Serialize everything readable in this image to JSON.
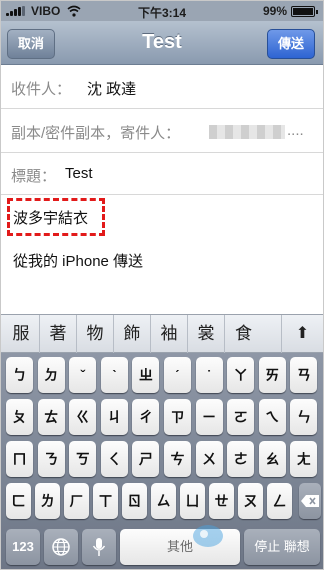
{
  "status_bar": {
    "carrier": "VIBO",
    "time": "下午3:14",
    "battery": "99%"
  },
  "nav": {
    "cancel": "取消",
    "title": "Test",
    "send": "傳送"
  },
  "form": {
    "to_label": "收件人：",
    "to_value": "沈 政達",
    "cc_label": "副本/密件副本，寄件人：",
    "cc_more": "....",
    "subject_label": "標題：",
    "subject_value": "Test"
  },
  "body": {
    "typed_text": "波多宇結衣",
    "signature": "從我的 iPhone 傳送"
  },
  "candidates": {
    "items": [
      "服",
      "著",
      "物",
      "飾",
      "袖",
      "裳",
      "食"
    ],
    "expand": "⬆"
  },
  "keyboard": {
    "row1": [
      "ㄅ",
      "ㄉ",
      "ˇ",
      "ˋ",
      "ㄓ",
      "ˊ",
      "˙",
      "ㄚ",
      "ㄞ",
      "ㄢ"
    ],
    "row2": [
      "ㄆ",
      "ㄊ",
      "ㄍ",
      "ㄐ",
      "ㄔ",
      "ㄗ",
      "ㄧ",
      "ㄛ",
      "ㄟ",
      "ㄣ"
    ],
    "row3": [
      "ㄇ",
      "ㄋ",
      "ㄎ",
      "ㄑ",
      "ㄕ",
      "ㄘ",
      "ㄨ",
      "ㄜ",
      "ㄠ",
      "ㄤ"
    ],
    "row4": [
      "ㄈ",
      "ㄌ",
      "ㄏ",
      "ㄒ",
      "ㄖ",
      "ㄙ",
      "ㄩ",
      "ㄝ",
      "ㄡ",
      "ㄥ"
    ],
    "numbers": "123",
    "space": "其他",
    "return": "停止 聯想"
  },
  "watermark": {
    "line1": "",
    "line2": ""
  },
  "colors": {
    "nav": "#8a9aaf",
    "send_button": "#2e64d2",
    "highlight_border": "#e21a1a"
  }
}
